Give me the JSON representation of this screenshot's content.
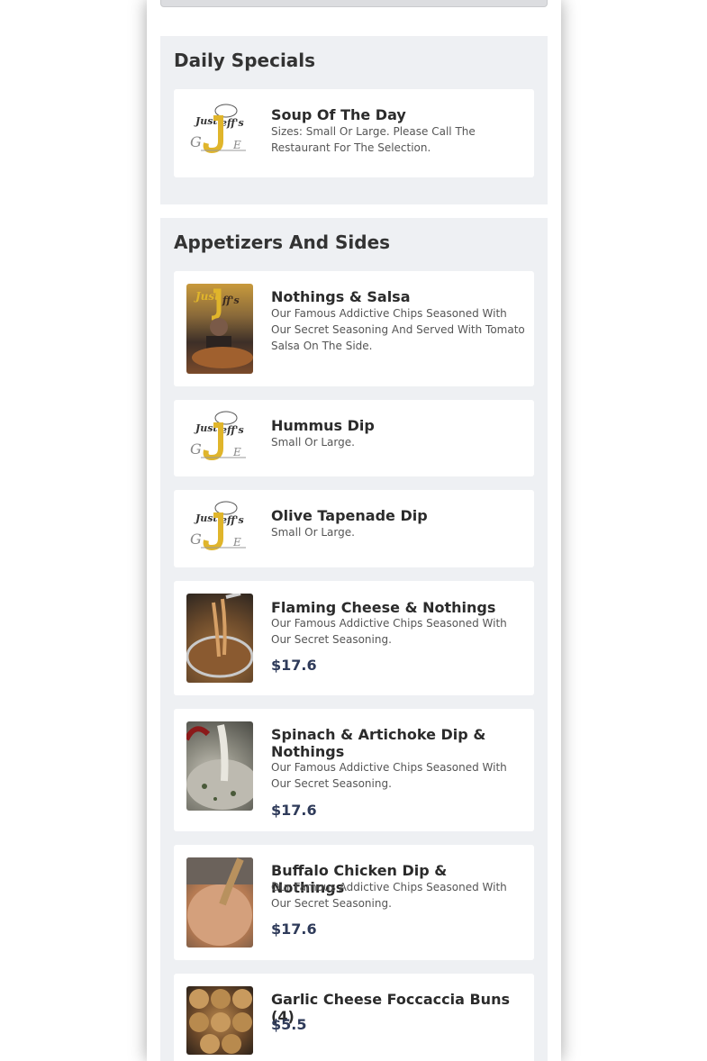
{
  "sections": [
    {
      "title": "Daily Specials",
      "items": [
        {
          "name": "Soup Of The Day",
          "description": "Sizes: Small Or Large. Please Call The Restaurant For The Selection.",
          "image": "restaurant-logo"
        }
      ]
    },
    {
      "title": "Appetizers And Sides",
      "items": [
        {
          "name": "Nothings & Salsa",
          "description": "Our Famous Addictive Chips Seasoned With Our Secret Seasoning And Served With Tomato Salsa On The Side.",
          "image": "photo"
        },
        {
          "name": "Hummus Dip",
          "description": "Small Or Large.",
          "image": "restaurant-logo"
        },
        {
          "name": "Olive Tapenade Dip",
          "description": "Small Or Large.",
          "image": "restaurant-logo"
        },
        {
          "name": "Flaming Cheese & Nothings",
          "description": "Our Famous Addictive Chips Seasoned With Our Secret Seasoning.",
          "price": "$17.6",
          "image": "photo"
        },
        {
          "name": "Spinach & Artichoke Dip & Nothings",
          "description": "Our Famous Addictive Chips Seasoned With Our Secret Seasoning.",
          "price": "$17.6",
          "image": "photo"
        },
        {
          "name": "Buffalo Chicken Dip & Nothings",
          "description": "Our Famous Addictive Chips Seasoned With Our Secret Seasoning.",
          "price": "$17.6",
          "image": "photo"
        },
        {
          "name": "Garlic Cheese Foccaccia Buns (4)",
          "price": "$5.5",
          "image": "photo"
        }
      ]
    }
  ],
  "logo_text": "Just Jeff's Gourmet Express",
  "colors": {
    "section_bg": "#eef0f3",
    "card_bg": "#ffffff",
    "price": "#2f3b5a",
    "logo_gold": "#e0b52b"
  }
}
